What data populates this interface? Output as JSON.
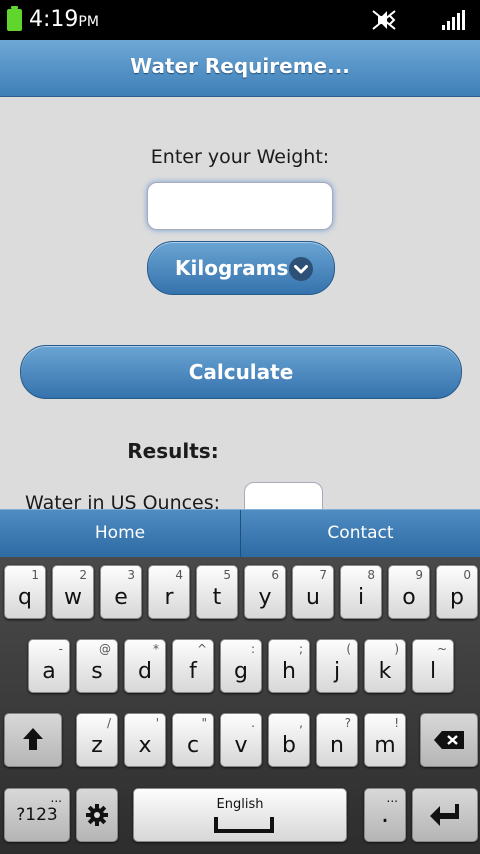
{
  "status": {
    "time": "4:19",
    "ampm": "PM",
    "icons": [
      "battery-icon",
      "mute-icon",
      "signal-icon"
    ]
  },
  "header": {
    "title": "Water Requireme..."
  },
  "form": {
    "weight_label": "Enter your Weight:",
    "weight_value": "",
    "unit_selected": "Kilograms",
    "calculate_label": "Calculate",
    "results_label": "Results:",
    "ounces_label": "Water in US Ounces:",
    "ounces_value": ""
  },
  "nav": {
    "home": "Home",
    "contact": "Contact"
  },
  "keyboard": {
    "row1": [
      {
        "k": "q",
        "a": "1"
      },
      {
        "k": "w",
        "a": "2"
      },
      {
        "k": "e",
        "a": "3"
      },
      {
        "k": "r",
        "a": "4"
      },
      {
        "k": "t",
        "a": "5"
      },
      {
        "k": "y",
        "a": "6"
      },
      {
        "k": "u",
        "a": "7"
      },
      {
        "k": "i",
        "a": "8"
      },
      {
        "k": "o",
        "a": "9"
      },
      {
        "k": "p",
        "a": "0"
      }
    ],
    "row2": [
      {
        "k": "a",
        "a": "-"
      },
      {
        "k": "s",
        "a": "@"
      },
      {
        "k": "d",
        "a": "*"
      },
      {
        "k": "f",
        "a": "^"
      },
      {
        "k": "g",
        "a": ":"
      },
      {
        "k": "h",
        "a": ";"
      },
      {
        "k": "j",
        "a": "("
      },
      {
        "k": "k",
        "a": ")"
      },
      {
        "k": "l",
        "a": "~"
      }
    ],
    "row3": [
      {
        "k": "z",
        "a": "/"
      },
      {
        "k": "x",
        "a": "'"
      },
      {
        "k": "c",
        "a": "\""
      },
      {
        "k": "v",
        "a": "."
      },
      {
        "k": "b",
        "a": ","
      },
      {
        "k": "n",
        "a": "?"
      },
      {
        "k": "m",
        "a": "!"
      }
    ],
    "sym_label": "?123",
    "sym_dots": "...",
    "space_label": "English",
    "period_label": ".",
    "period_dots": "...",
    "accent": "#3e7fb7"
  }
}
